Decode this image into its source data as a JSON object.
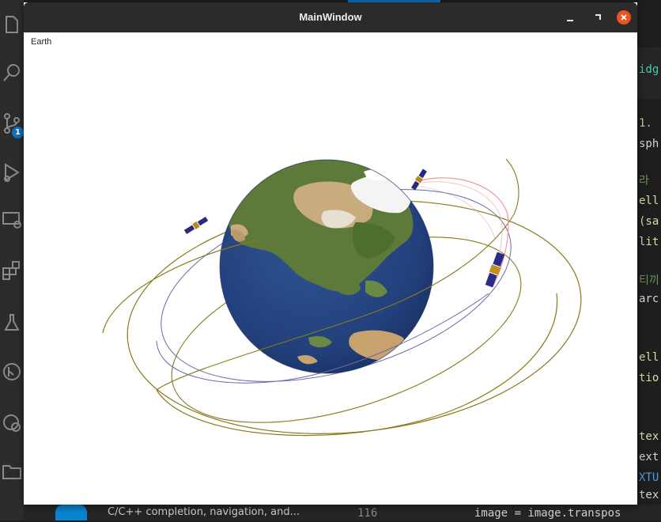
{
  "window": {
    "title": "MainWindow"
  },
  "viewport": {
    "label": "Earth"
  },
  "editor": {
    "status_text": "C/C++ completion, navigation, and...",
    "line_number": "116",
    "code_line": "image = image.transpos",
    "right_fragments": [
      "idg",
      "1.",
      "sph",
      "라",
      "ell",
      "(sa",
      "lit",
      "티끼",
      "arc",
      "ell",
      "tio",
      "tex",
      "ext",
      "XTU",
      "tex"
    ]
  },
  "icons": {
    "activity_bar": [
      "explorer-icon",
      "search-icon",
      "source-control-icon",
      "run-debug-icon",
      "remote-explorer-icon",
      "extensions-icon",
      "testing-icon",
      "git-graph-icon",
      "settings-sync-icon",
      "folder-icon"
    ],
    "source_control_badge": "1"
  },
  "colors": {
    "orbit_gold": "#8a7a1a",
    "orbit_purple": "#6a66a8",
    "orbit_pink": "#f09a9a",
    "ocean": "#223f7a",
    "land": "#5e7a3a",
    "desert": "#c8ac7e"
  }
}
